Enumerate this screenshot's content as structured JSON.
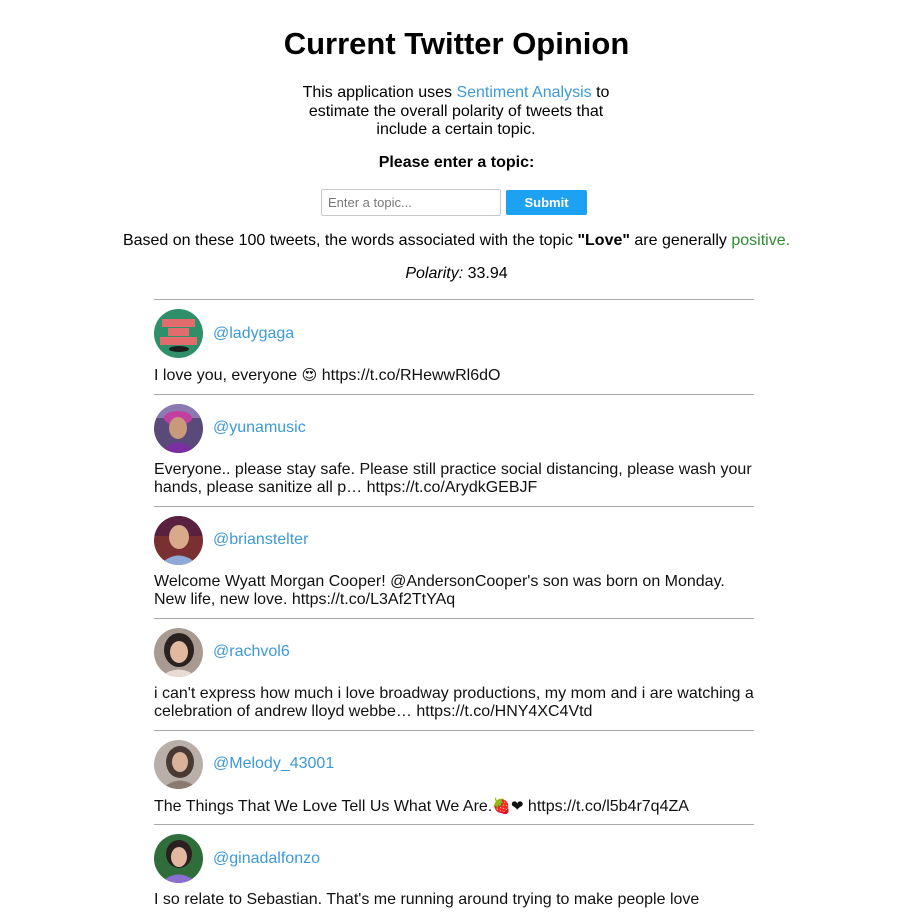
{
  "header": {
    "title": "Current Twitter Opinion"
  },
  "intro": {
    "before_link": "This application uses ",
    "link_text": "Sentiment Analysis",
    "after_link": " to estimate the overall polarity of tweets that include a certain topic."
  },
  "form": {
    "prompt": "Please enter a topic:",
    "input_placeholder": "Enter a topic...",
    "input_value": "",
    "submit_label": "Submit"
  },
  "result": {
    "prefix": "Based on these 100 tweets, the words associated with the topic ",
    "topic": "\"Love\"",
    "middle": " are generally ",
    "sentiment": "positive.",
    "polarity_label": "Polarity:",
    "polarity_value": " 33.94"
  },
  "colors": {
    "link": "#3d9ad6",
    "submit_button": "#1da1f2",
    "positive": "#2e8b2e",
    "divider": "#a8a8a8"
  },
  "tweets": [
    {
      "handle": "@ladygaga",
      "avatar_icon": "ladygaga-avatar",
      "text": "I love you, everyone ",
      "emoji": "😍",
      "link": " https://t.co/RHewwRl6dO"
    },
    {
      "handle": "@yunamusic",
      "avatar_icon": "yunamusic-avatar",
      "text": "Everyone.. please stay safe. Please still practice social distancing, please wash your hands, please sanitize all p… https://t.co/ArydkGEBJF",
      "emoji": "",
      "link": ""
    },
    {
      "handle": "@brianstelter",
      "avatar_icon": "brianstelter-avatar",
      "text": "Welcome Wyatt Morgan Cooper! @AndersonCooper's son was born on Monday. New life, new love. https://t.co/L3Af2TtYAq",
      "emoji": "",
      "link": ""
    },
    {
      "handle": "@rachvol6",
      "avatar_icon": "rachvol6-avatar",
      "text": "i can't express how much i love broadway productions, my mom and i are watching a celebration of andrew lloyd webbe… https://t.co/HNY4XC4Vtd",
      "emoji": "",
      "link": ""
    },
    {
      "handle": "@Melody_43001",
      "avatar_icon": "melody-avatar",
      "text": "The Things That We Love Tell Us What We Are.",
      "emoji": "🍓❤",
      "link": " https://t.co/l5b4r7q4ZA"
    },
    {
      "handle": "@ginadalfonzo",
      "avatar_icon": "ginadalfonzo-avatar",
      "text": "I so relate to Sebastian. That's me running around trying to make people love",
      "emoji": "",
      "link": ""
    }
  ]
}
